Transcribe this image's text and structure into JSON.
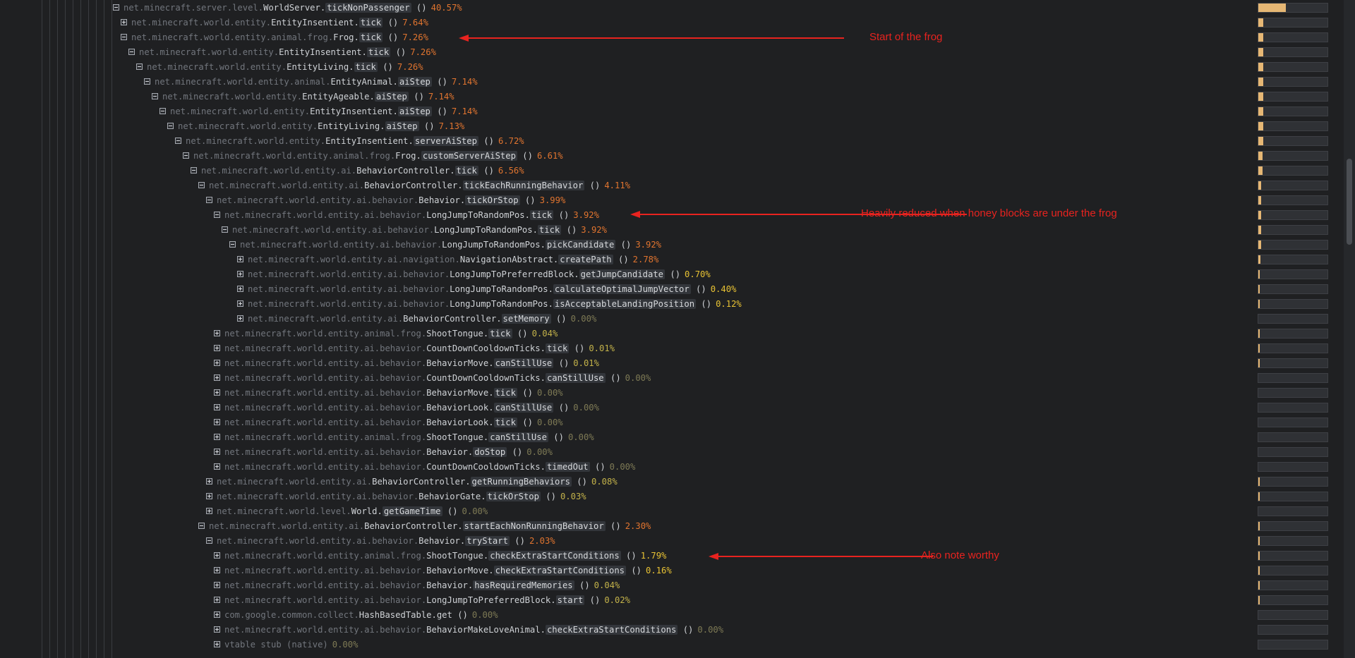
{
  "colors": {
    "hot": "#e0742f",
    "warm": "#e8c234",
    "mild": "#c3b24a",
    "cold": "#7e7a55",
    "arrow": "#e8231f",
    "bar": "#e6b774"
  },
  "icons": {
    "collapse": "minus-box-icon",
    "expand": "plus-box-icon"
  },
  "rows": [
    {
      "d": 0,
      "t": "-",
      "pkg": "net.minecraft.server.level.",
      "cls": "WorldServer.",
      "m": "tickNonPassenger",
      "pct": "40.57%",
      "v": 40.57
    },
    {
      "d": 1,
      "t": "+",
      "pkg": "net.minecraft.world.entity.",
      "cls": "EntityInsentient.",
      "m": "tick",
      "pct": "7.64%",
      "v": 7.64
    },
    {
      "d": 1,
      "t": "-",
      "pkg": "net.minecraft.world.entity.animal.frog.",
      "cls": "Frog.",
      "m": "tick",
      "pct": "7.26%",
      "v": 7.26
    },
    {
      "d": 2,
      "t": "-",
      "pkg": "net.minecraft.world.entity.",
      "cls": "EntityInsentient.",
      "m": "tick",
      "pct": "7.26%",
      "v": 7.26
    },
    {
      "d": 3,
      "t": "-",
      "pkg": "net.minecraft.world.entity.",
      "cls": "EntityLiving.",
      "m": "tick",
      "pct": "7.26%",
      "v": 7.26
    },
    {
      "d": 4,
      "t": "-",
      "pkg": "net.minecraft.world.entity.animal.",
      "cls": "EntityAnimal.",
      "m": "aiStep",
      "pct": "7.14%",
      "v": 7.14
    },
    {
      "d": 5,
      "t": "-",
      "pkg": "net.minecraft.world.entity.",
      "cls": "EntityAgeable.",
      "m": "aiStep",
      "pct": "7.14%",
      "v": 7.14
    },
    {
      "d": 6,
      "t": "-",
      "pkg": "net.minecraft.world.entity.",
      "cls": "EntityInsentient.",
      "m": "aiStep",
      "pct": "7.14%",
      "v": 7.14
    },
    {
      "d": 7,
      "t": "-",
      "pkg": "net.minecraft.world.entity.",
      "cls": "EntityLiving.",
      "m": "aiStep",
      "pct": "7.13%",
      "v": 7.13
    },
    {
      "d": 8,
      "t": "-",
      "pkg": "net.minecraft.world.entity.",
      "cls": "EntityInsentient.",
      "m": "serverAiStep",
      "pct": "6.72%",
      "v": 6.72
    },
    {
      "d": 9,
      "t": "-",
      "pkg": "net.minecraft.world.entity.animal.frog.",
      "cls": "Frog.",
      "m": "customServerAiStep",
      "pct": "6.61%",
      "v": 6.61
    },
    {
      "d": 10,
      "t": "-",
      "pkg": "net.minecraft.world.entity.ai.",
      "cls": "BehaviorController.",
      "m": "tick",
      "pct": "6.56%",
      "v": 6.56
    },
    {
      "d": 11,
      "t": "-",
      "pkg": "net.minecraft.world.entity.ai.",
      "cls": "BehaviorController.",
      "m": "tickEachRunningBehavior",
      "pct": "4.11%",
      "v": 4.11
    },
    {
      "d": 12,
      "t": "-",
      "pkg": "net.minecraft.world.entity.ai.behavior.",
      "cls": "Behavior.",
      "m": "tickOrStop",
      "pct": "3.99%",
      "v": 3.99
    },
    {
      "d": 13,
      "t": "-",
      "pkg": "net.minecraft.world.entity.ai.behavior.",
      "cls": "LongJumpToRandomPos.",
      "m": "tick",
      "pct": "3.92%",
      "v": 3.92
    },
    {
      "d": 14,
      "t": "-",
      "pkg": "net.minecraft.world.entity.ai.behavior.",
      "cls": "LongJumpToRandomPos.",
      "m": "tick",
      "pct": "3.92%",
      "v": 3.92
    },
    {
      "d": 15,
      "t": "-",
      "pkg": "net.minecraft.world.entity.ai.behavior.",
      "cls": "LongJumpToRandomPos.",
      "m": "pickCandidate",
      "pct": "3.92%",
      "v": 3.92
    },
    {
      "d": 16,
      "t": "+",
      "pkg": "net.minecraft.world.entity.ai.navigation.",
      "cls": "NavigationAbstract.",
      "m": "createPath",
      "pct": "2.78%",
      "v": 2.78
    },
    {
      "d": 16,
      "t": "+",
      "pkg": "net.minecraft.world.entity.ai.behavior.",
      "cls": "LongJumpToPreferredBlock.",
      "m": "getJumpCandidate",
      "pct": "0.70%",
      "v": 0.7
    },
    {
      "d": 16,
      "t": "+",
      "pkg": "net.minecraft.world.entity.ai.behavior.",
      "cls": "LongJumpToRandomPos.",
      "m": "calculateOptimalJumpVector",
      "pct": "0.40%",
      "v": 0.4
    },
    {
      "d": 16,
      "t": "+",
      "pkg": "net.minecraft.world.entity.ai.behavior.",
      "cls": "LongJumpToRandomPos.",
      "m": "isAcceptableLandingPosition",
      "pct": "0.12%",
      "v": 0.12
    },
    {
      "d": 16,
      "t": "+",
      "pkg": "net.minecraft.world.entity.ai.",
      "cls": "BehaviorController.",
      "m": "setMemory",
      "pct": "0.00%",
      "v": 0.0
    },
    {
      "d": 13,
      "t": "+",
      "pkg": "net.minecraft.world.entity.animal.frog.",
      "cls": "ShootTongue.",
      "m": "tick",
      "pct": "0.04%",
      "v": 0.04
    },
    {
      "d": 13,
      "t": "+",
      "pkg": "net.minecraft.world.entity.ai.behavior.",
      "cls": "CountDownCooldownTicks.",
      "m": "tick",
      "pct": "0.01%",
      "v": 0.01
    },
    {
      "d": 13,
      "t": "+",
      "pkg": "net.minecraft.world.entity.ai.behavior.",
      "cls": "BehaviorMove.",
      "m": "canStillUse",
      "pct": "0.01%",
      "v": 0.01
    },
    {
      "d": 13,
      "t": "+",
      "pkg": "net.minecraft.world.entity.ai.behavior.",
      "cls": "CountDownCooldownTicks.",
      "m": "canStillUse",
      "pct": "0.00%",
      "v": 0.0
    },
    {
      "d": 13,
      "t": "+",
      "pkg": "net.minecraft.world.entity.ai.behavior.",
      "cls": "BehaviorMove.",
      "m": "tick",
      "pct": "0.00%",
      "v": 0.0
    },
    {
      "d": 13,
      "t": "+",
      "pkg": "net.minecraft.world.entity.ai.behavior.",
      "cls": "BehaviorLook.",
      "m": "canStillUse",
      "pct": "0.00%",
      "v": 0.0
    },
    {
      "d": 13,
      "t": "+",
      "pkg": "net.minecraft.world.entity.ai.behavior.",
      "cls": "BehaviorLook.",
      "m": "tick",
      "pct": "0.00%",
      "v": 0.0
    },
    {
      "d": 13,
      "t": "+",
      "pkg": "net.minecraft.world.entity.animal.frog.",
      "cls": "ShootTongue.",
      "m": "canStillUse",
      "pct": "0.00%",
      "v": 0.0
    },
    {
      "d": 13,
      "t": "+",
      "pkg": "net.minecraft.world.entity.ai.behavior.",
      "cls": "Behavior.",
      "m": "doStop",
      "pct": "0.00%",
      "v": 0.0
    },
    {
      "d": 13,
      "t": "+",
      "pkg": "net.minecraft.world.entity.ai.behavior.",
      "cls": "CountDownCooldownTicks.",
      "m": "timedOut",
      "pct": "0.00%",
      "v": 0.0
    },
    {
      "d": 12,
      "t": "+",
      "pkg": "net.minecraft.world.entity.ai.",
      "cls": "BehaviorController.",
      "m": "getRunningBehaviors",
      "pct": "0.08%",
      "v": 0.08
    },
    {
      "d": 12,
      "t": "+",
      "pkg": "net.minecraft.world.entity.ai.behavior.",
      "cls": "BehaviorGate.",
      "m": "tickOrStop",
      "pct": "0.03%",
      "v": 0.03
    },
    {
      "d": 12,
      "t": "+",
      "pkg": "net.minecraft.world.level.",
      "cls": "World.",
      "m": "getGameTime",
      "pct": "0.00%",
      "v": 0.0
    },
    {
      "d": 11,
      "t": "-",
      "pkg": "net.minecraft.world.entity.ai.",
      "cls": "BehaviorController.",
      "m": "startEachNonRunningBehavior",
      "pct": "2.30%",
      "v": 2.3
    },
    {
      "d": 12,
      "t": "-",
      "pkg": "net.minecraft.world.entity.ai.behavior.",
      "cls": "Behavior.",
      "m": "tryStart",
      "pct": "2.03%",
      "v": 2.03
    },
    {
      "d": 13,
      "t": "+",
      "pkg": "net.minecraft.world.entity.animal.frog.",
      "cls": "ShootTongue.",
      "m": "checkExtraStartConditions",
      "pct": "1.79%",
      "v": 1.79
    },
    {
      "d": 13,
      "t": "+",
      "pkg": "net.minecraft.world.entity.ai.behavior.",
      "cls": "BehaviorMove.",
      "m": "checkExtraStartConditions",
      "pct": "0.16%",
      "v": 0.16
    },
    {
      "d": 13,
      "t": "+",
      "pkg": "net.minecraft.world.entity.ai.behavior.",
      "cls": "Behavior.",
      "m": "hasRequiredMemories",
      "pct": "0.04%",
      "v": 0.04
    },
    {
      "d": 13,
      "t": "+",
      "pkg": "net.minecraft.world.entity.ai.behavior.",
      "cls": "LongJumpToPreferredBlock.",
      "m": "start",
      "pct": "0.02%",
      "v": 0.02
    },
    {
      "d": 13,
      "t": "+",
      "pkg": "com.google.common.collect.",
      "cls": "HashBasedTable.get",
      "m": "",
      "pct": "0.00%",
      "v": 0.0
    },
    {
      "d": 13,
      "t": "+",
      "pkg": "net.minecraft.world.entity.ai.behavior.",
      "cls": "BehaviorMakeLoveAnimal.",
      "m": "checkExtraStartConditions",
      "pct": "0.00%",
      "v": 0.0
    },
    {
      "d": 13,
      "t": "+",
      "pkg": "vtable stub (native)",
      "cls": "",
      "m": "",
      "pct": "0.00%",
      "v": 0.0,
      "nop": true
    }
  ],
  "annotations": [
    {
      "text": "Start of the frog",
      "row": 2
    },
    {
      "text": "Heavily reduced when honey blocks are under the frog",
      "row": 14
    },
    {
      "text": "Also note worthy",
      "row": 37
    }
  ]
}
